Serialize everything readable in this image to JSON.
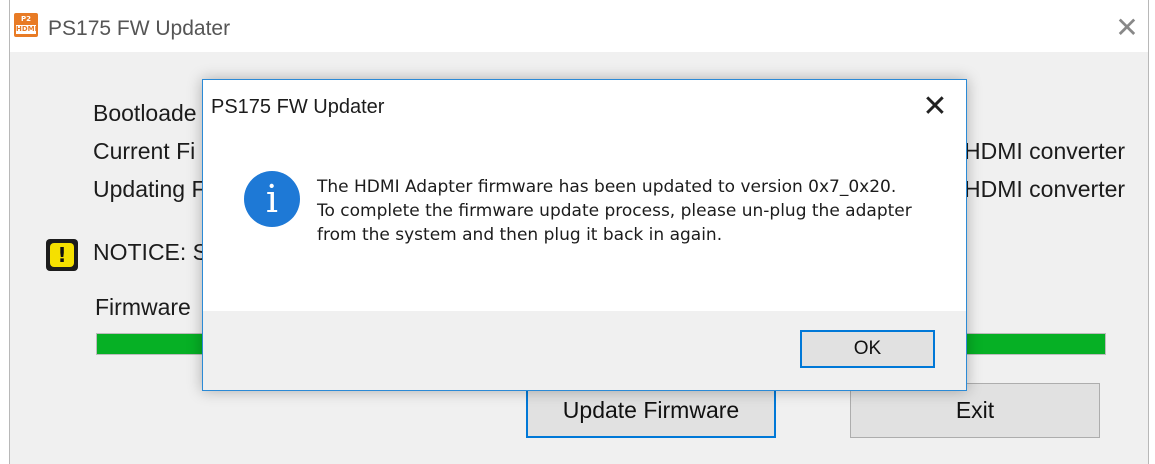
{
  "main_window": {
    "title": "PS175 FW Updater",
    "app_icon_text_top": "P2",
    "app_icon_text_bottom": "HDMI",
    "fields": {
      "bootloader": "Bootloade",
      "current": "Current Fi",
      "updating": "Updating F",
      "current_right": "HDMI converter",
      "updating_right": "HDMI converter",
      "notice": "NOTICE: S",
      "firmware_label": "Firmware"
    },
    "progress_percent": 100,
    "buttons": {
      "update": "Update Firmware",
      "exit": "Exit"
    }
  },
  "dialog": {
    "title": "PS175 FW Updater",
    "message": "The HDMI Adapter firmware has been updated to version 0x7_0x20.  To complete the firmware update process, please un-plug the adapter from the system and then plug it back in again.",
    "ok_label": "OK"
  },
  "colors": {
    "accent": "#0078d7",
    "progress": "#06b025",
    "info_icon": "#1e79d6",
    "notice_icon": "#f5e000"
  }
}
